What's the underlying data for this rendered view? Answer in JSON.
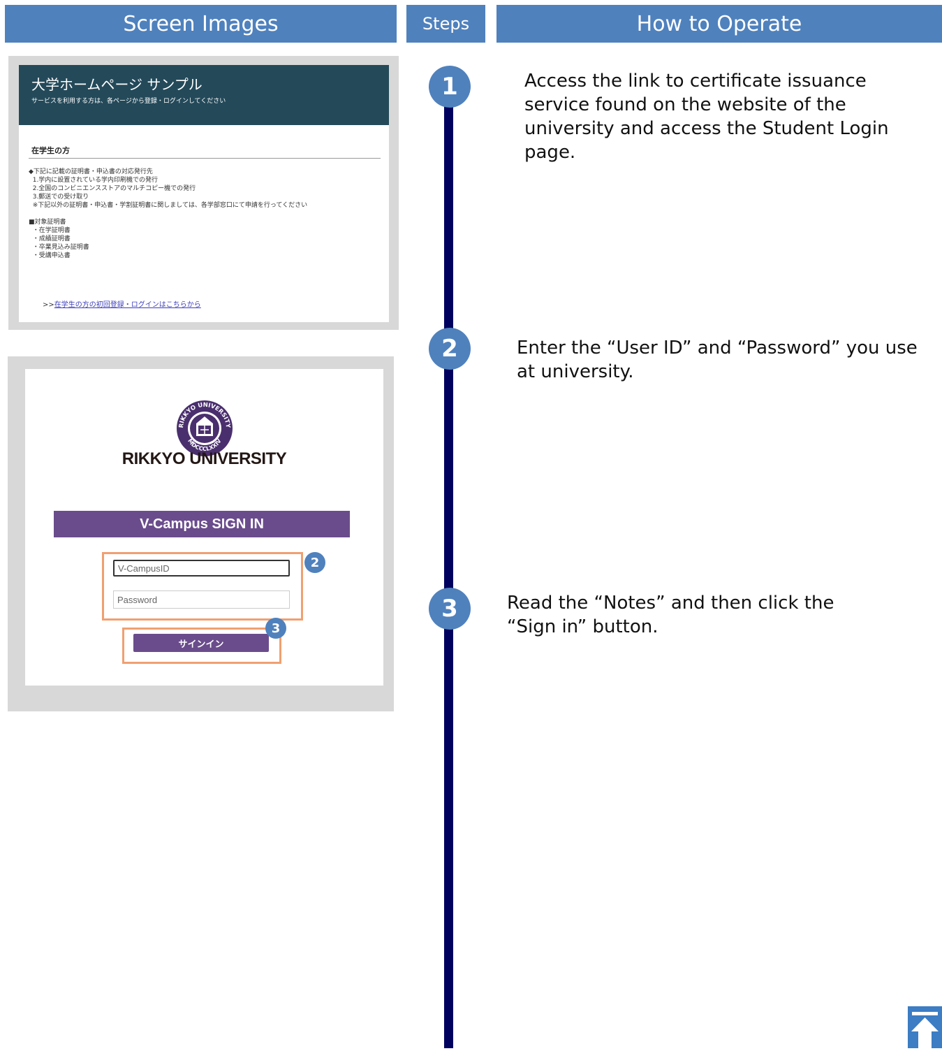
{
  "headers": {
    "screens": "Screen Images",
    "steps": "Steps",
    "howto": "How to Operate"
  },
  "steps": [
    {
      "number": "1",
      "text": "Access the link to certificate issuance\nservice found on the website of the\nuniversity and access the Student Login\npage."
    },
    {
      "number": "2",
      "text": "Enter the “User ID” and “Password” you use\nat university."
    },
    {
      "number": "3",
      "text": "Read the “Notes” and then click the\n“Sign in” button."
    }
  ],
  "screen1": {
    "title": "大学ホームページ サンプル",
    "subtitle": "サービスを利用する方は、各ページから登録・ログインしてください",
    "heading": "在学生の方",
    "body": "◆下記に記載の証明書・申込書の対応発行先\n  1.学内に設置されている学内印刷機での発行\n  2.全国のコンビニエンスストアのマルチコピー機での発行\n  3.郵送での受け取り\n  ※下記以外の証明書・申込書・学割証明書に関しましては、各学部窓口にて申請を行ってください\n\n■対象証明書\n  ・在学証明書\n  ・成績証明書\n  ・卒業見込み証明書\n  ・受講申込書",
    "link_prefix": ">>",
    "link_text": "在学生の方の初回登録・ログインはこちらから"
  },
  "screen2": {
    "university": "RIKKYO UNIVERSITY",
    "signin_title": "V-Campus SIGN IN",
    "userid_value": "V-CampusID",
    "password_placeholder": "Password",
    "signin_button": "サインイン",
    "badge_2": "2",
    "badge_3": "3",
    "logo_text_top": "RIKKYO UNIVERSITY",
    "logo_text_bottom": "MDCCCLXXIV"
  },
  "colors": {
    "header": "#4f81bd",
    "timeline": "#00005e",
    "banner": "#244a5a",
    "purple": "#6a4c8c",
    "highlight": "#f0a070"
  },
  "icons": {
    "page_top": "arrow-up-icon",
    "logo": "rikkyo-seal-logo"
  }
}
